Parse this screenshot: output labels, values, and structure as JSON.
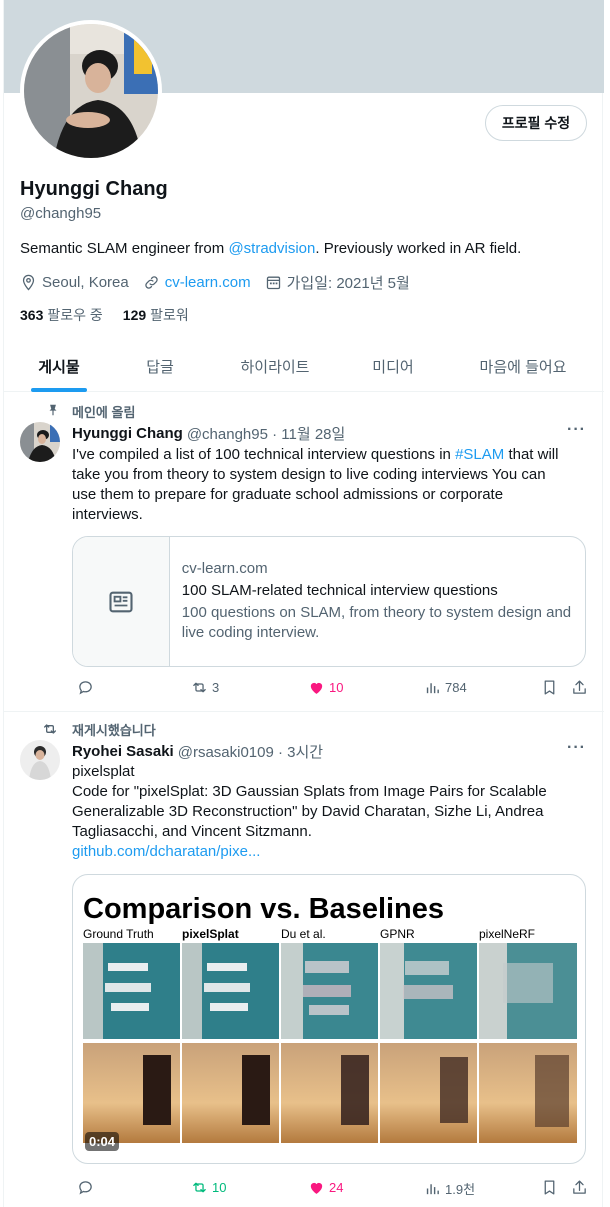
{
  "profile": {
    "edit_label": "프로필 수정",
    "name": "Hyunggi Chang",
    "handle": "@changh95",
    "bio_prefix": "Semantic SLAM engineer from ",
    "bio_mention": "@stradvision",
    "bio_suffix": ". Previously worked in AR field.",
    "location": "Seoul, Korea",
    "website": "cv-learn.com",
    "joined": "가입일: 2021년 5월",
    "following_count": "363",
    "following_label": "팔로우 중",
    "followers_count": "129",
    "followers_label": "팔로워"
  },
  "tabs": [
    "게시물",
    "답글",
    "하이라이트",
    "미디어",
    "마음에 들어요"
  ],
  "posts": [
    {
      "context": "메인에 올림",
      "author": "Hyunggi Chang",
      "meta": "@changh95 · 11월 28일",
      "text_a": "I've compiled a list of 100 technical interview questions in ",
      "hashtag": "#SLAM",
      "text_b": " that will take you from theory to system design to live coding interviews You can use them to prepare for graduate school admissions or corporate interviews.",
      "card": {
        "domain": "cv-learn.com",
        "title": "100 SLAM-related technical interview questions",
        "desc": "100 questions on SLAM, from theory to system design and live coding interview."
      },
      "replies": "",
      "reposts": "3",
      "likes": "10",
      "views": "784",
      "like_color": "#f91880",
      "repost_color": "#536471"
    },
    {
      "context": "재게시했습니다",
      "author": "Ryohei Sasaki",
      "meta": "@rsasaki0109 · 3시간",
      "title_line": "pixelsplat",
      "text": "Code for \"pixelSplat: 3D Gaussian Splats from Image Pairs for Scalable Generalizable 3D Reconstruction\" by David Charatan, Sizhe Li, Andrea Tagliasacchi, and Vincent Sitzmann.",
      "link": "github.com/dcharatan/pixe...",
      "media": {
        "title": "Comparison vs. Baselines",
        "columns": [
          "Ground Truth",
          "pixelSplat",
          "Du et al.",
          "GPNR",
          "pixelNeRF"
        ],
        "duration": "0:04"
      },
      "replies": "",
      "reposts": "10",
      "likes": "24",
      "views": "1.9천",
      "like_color": "#f91880",
      "repost_color": "#00ba7c"
    }
  ],
  "colors": {
    "accent": "#1d9bf0",
    "banner": "#cfd9de",
    "muted": "#536471"
  }
}
